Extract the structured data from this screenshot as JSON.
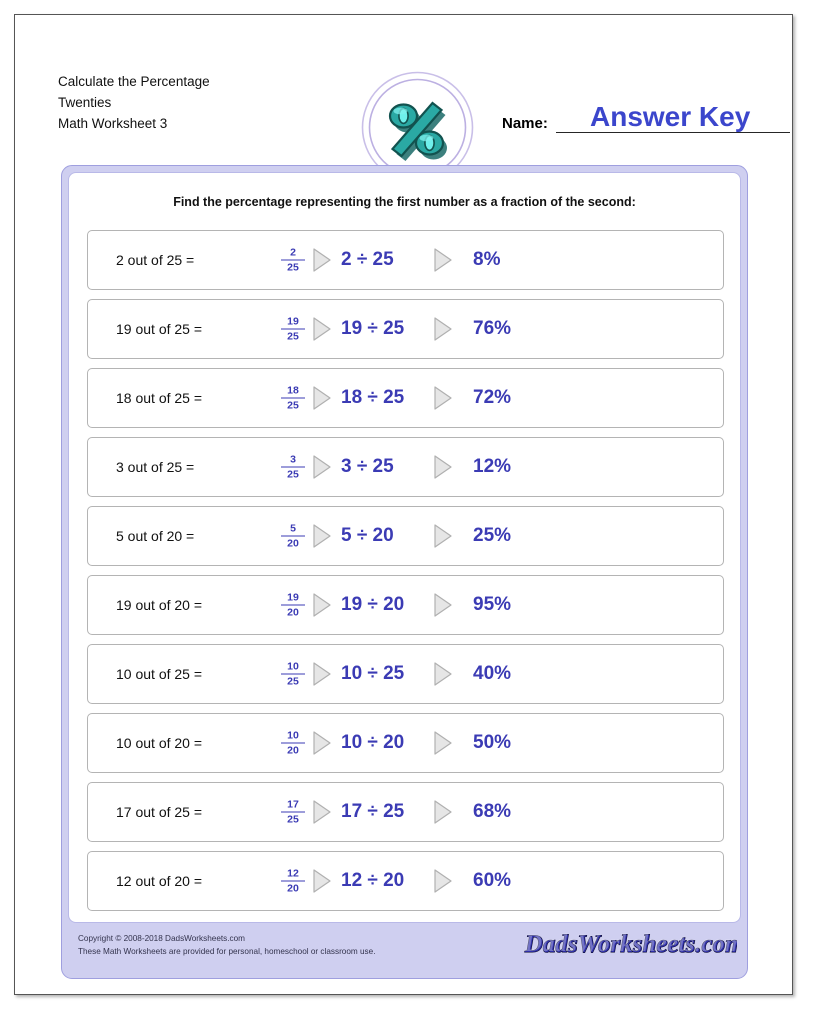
{
  "header": {
    "title_lines": [
      "Calculate the Percentage",
      "Twenties",
      "Math Worksheet 3"
    ],
    "logo_icon": "percent-sign-logo",
    "name_label": "Name:",
    "name_value": "Answer Key",
    "answer_key_color": "#3b46cc"
  },
  "worksheet": {
    "instruction": "Find the percentage representing the first number as a fraction of the second:",
    "arrow_icon": "right-triangle-arrow",
    "accent_color": "#3b3bb4",
    "panel_color": "#cfcff0",
    "problems": [
      {
        "prompt": "2 out of 25 =",
        "numerator": "2",
        "denominator": "25",
        "division": "2 ÷ 25",
        "answer": "8%"
      },
      {
        "prompt": "19 out of 25 =",
        "numerator": "19",
        "denominator": "25",
        "division": "19 ÷ 25",
        "answer": "76%"
      },
      {
        "prompt": "18 out of 25 =",
        "numerator": "18",
        "denominator": "25",
        "division": "18 ÷ 25",
        "answer": "72%"
      },
      {
        "prompt": "3 out of 25 =",
        "numerator": "3",
        "denominator": "25",
        "division": "3 ÷ 25",
        "answer": "12%"
      },
      {
        "prompt": "5 out of 20 =",
        "numerator": "5",
        "denominator": "20",
        "division": "5 ÷ 20",
        "answer": "25%"
      },
      {
        "prompt": "19 out of 20 =",
        "numerator": "19",
        "denominator": "20",
        "division": "19 ÷ 20",
        "answer": "95%"
      },
      {
        "prompt": "10 out of 25 =",
        "numerator": "10",
        "denominator": "25",
        "division": "10 ÷ 25",
        "answer": "40%"
      },
      {
        "prompt": "10 out of 20 =",
        "numerator": "10",
        "denominator": "20",
        "division": "10 ÷ 20",
        "answer": "50%"
      },
      {
        "prompt": "17 out of 25 =",
        "numerator": "17",
        "denominator": "25",
        "division": "17 ÷ 25",
        "answer": "68%"
      },
      {
        "prompt": "12 out of 20 =",
        "numerator": "12",
        "denominator": "20",
        "division": "12 ÷ 20",
        "answer": "60%"
      }
    ]
  },
  "footer": {
    "copyright_line1": "Copyright © 2008-2018 DadsWorksheets.com",
    "copyright_line2": "These Math Worksheets are provided for personal, homeschool or classroom use.",
    "brand_logo": "DadsWorksheets.com"
  }
}
